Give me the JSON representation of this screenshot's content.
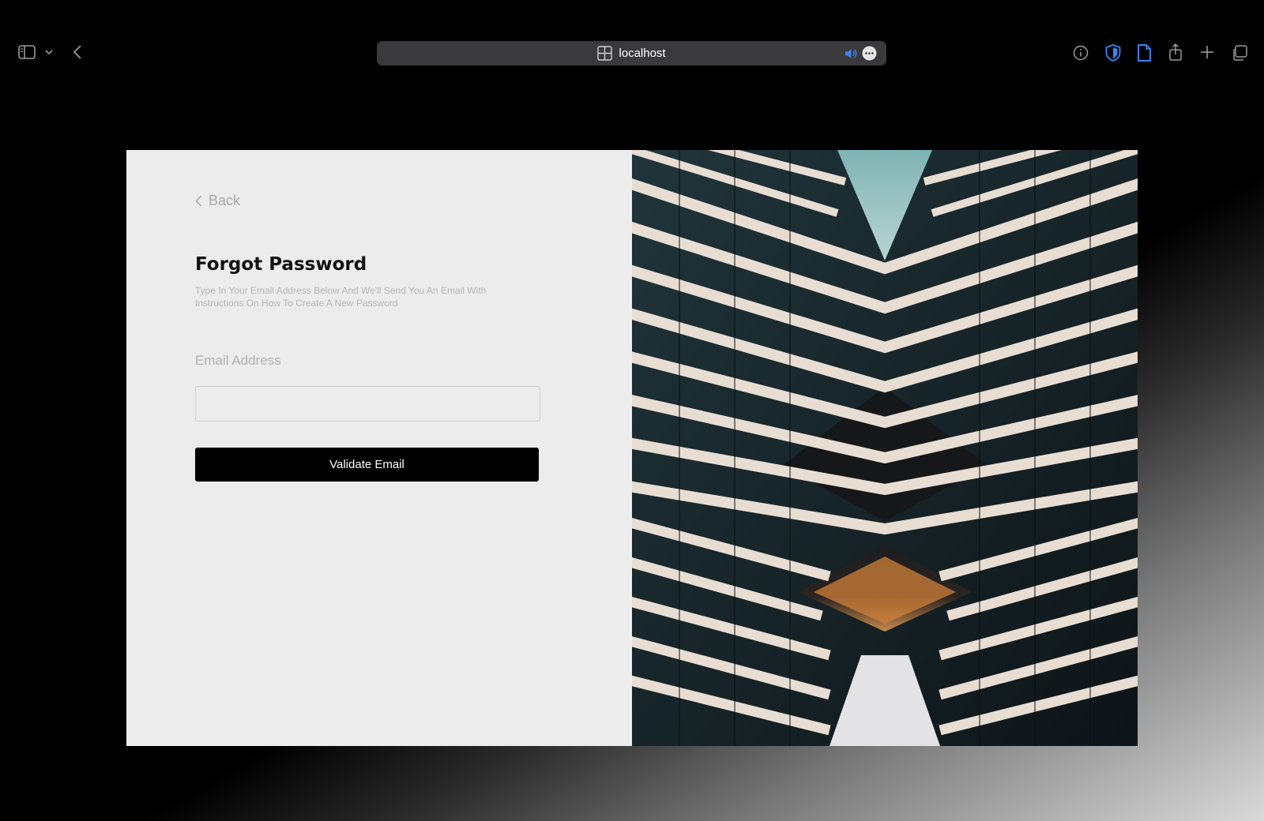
{
  "browser": {
    "address": "localhost",
    "icons": [
      "sidebar-icon",
      "chevron-down-icon",
      "back-arrow-icon",
      "tab-layout-icon",
      "speaker-icon",
      "more-icon",
      "info-icon",
      "shield-icon",
      "document-icon",
      "share-icon",
      "plus-icon",
      "tabs-icon"
    ],
    "accent_color": "#3b82f6"
  },
  "page": {
    "back_label": "Back",
    "title": "Forgot Password",
    "subtitle": "Type In Your Email Address Below And We'll Send You An Email With Instructions On How To Create A New Password",
    "email_label": "Email Address",
    "email_value": "",
    "email_placeholder": "",
    "submit_label": "Validate Email"
  },
  "colors": {
    "panel_bg": "#ececec",
    "button_bg": "#000000",
    "button_text": "#ffffff"
  }
}
